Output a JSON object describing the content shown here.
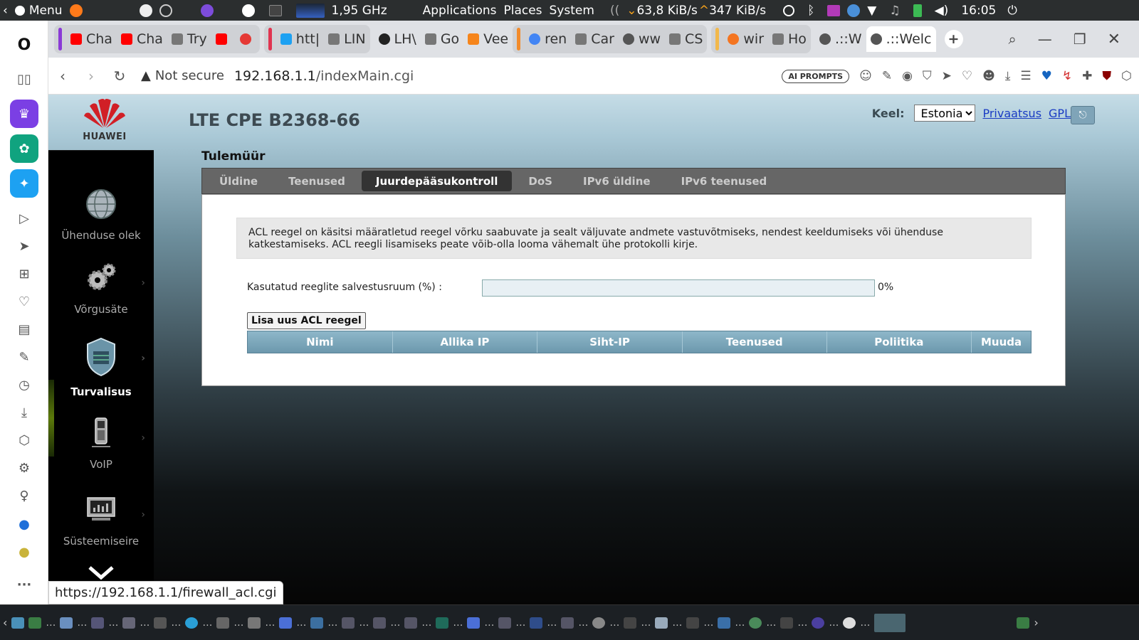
{
  "system_bar": {
    "menu_label": "Menu",
    "cpu_freq": "1,95 GHz",
    "applications_label": "Applications",
    "places_label": "Places",
    "system_label": "System",
    "net_down": "63,8 KiB/s",
    "net_up": "347 KiB/s",
    "clock": "16:05"
  },
  "browser": {
    "tabs": [
      {
        "label": "Cha",
        "icon": "youtube-icon",
        "color": "#ff0000"
      },
      {
        "label": "Cha",
        "icon": "youtube-icon",
        "color": "#ff0000"
      },
      {
        "label": "Try",
        "icon": "page-icon",
        "color": "#777777"
      },
      {
        "label": "",
        "icon": "youtube-icon",
        "color": "#ff0000"
      },
      {
        "label": "",
        "icon": "record-icon",
        "color": "#e53935"
      },
      {
        "label": "htt|",
        "icon": "twitter-icon",
        "color": "#1da1f2"
      },
      {
        "label": "LIN",
        "icon": "page-icon",
        "color": "#777777"
      },
      {
        "label": "LH\\",
        "icon": "lhv-icon",
        "color": "#222222"
      },
      {
        "label": "Go",
        "icon": "page-icon",
        "color": "#777777"
      },
      {
        "label": "Vee",
        "icon": "fox-icon",
        "color": "#f6851b"
      },
      {
        "label": "ren",
        "icon": "google-icon",
        "color": "#4285f4"
      },
      {
        "label": "Car",
        "icon": "page-icon",
        "color": "#777777"
      },
      {
        "label": "ww",
        "icon": "globe-icon",
        "color": "#555555"
      },
      {
        "label": "CS",
        "icon": "page-icon",
        "color": "#777777"
      },
      {
        "label": "wir",
        "icon": "ask-icon",
        "color": "#f47521"
      },
      {
        "label": "Ho",
        "icon": "page-icon",
        "color": "#777777"
      },
      {
        "label": ".::W",
        "icon": "globe-icon",
        "color": "#555555"
      },
      {
        "label": ".::Welc",
        "icon": "globe-icon",
        "color": "#555555"
      }
    ],
    "not_secure_label": "Not secure",
    "url_host": "192.168.1.1",
    "url_path": "/indexMain.cgi",
    "ai_prompts_label": "AI PROMPTS",
    "status_url": "https://192.168.1.1/firewall_acl.cgi"
  },
  "router": {
    "brand": "HUAWEI",
    "product_name": "LTE CPE B2368-66",
    "language_label": "Keel:",
    "language_value": "Estonia",
    "privacy_link": "Privaatsus",
    "gpl_link": "GPL",
    "menu": [
      {
        "label": "Ühenduse olek",
        "icon": "globe-icon"
      },
      {
        "label": "Võrgusäte",
        "icon": "gears-icon"
      },
      {
        "label": "Turvalisus",
        "icon": "shield-icon"
      },
      {
        "label": "VoIP",
        "icon": "phone-icon"
      },
      {
        "label": "Süsteemiseire",
        "icon": "monitor-icon"
      }
    ],
    "page_title": "Tulemüür",
    "tabs": [
      "Üldine",
      "Teenused",
      "Juurdepääsukontroll",
      "DoS",
      "IPv6 üldine",
      "IPv6 teenused"
    ],
    "active_tab": "Juurdepääsukontroll",
    "info_text": "ACL reegel on käsitsi määratletud reegel võrku saabuvate ja sealt väljuvate andmete vastuvõtmiseks, nendest keeldumiseks või ühenduse katkestamiseks. ACL reegli lisamiseks peate võib-olla looma vähemalt ühe protokolli kirje.",
    "usage_label": "Kasutatud reeglite salvestusruum (%) :",
    "usage_percent_text": "0%",
    "usage_fraction": 0,
    "add_button": "Lisa uus ACL reegel",
    "table_headers": [
      "Nimi",
      "Allika IP",
      "Siht-IP",
      "Teenused",
      "Poliitika",
      "Muuda"
    ]
  }
}
